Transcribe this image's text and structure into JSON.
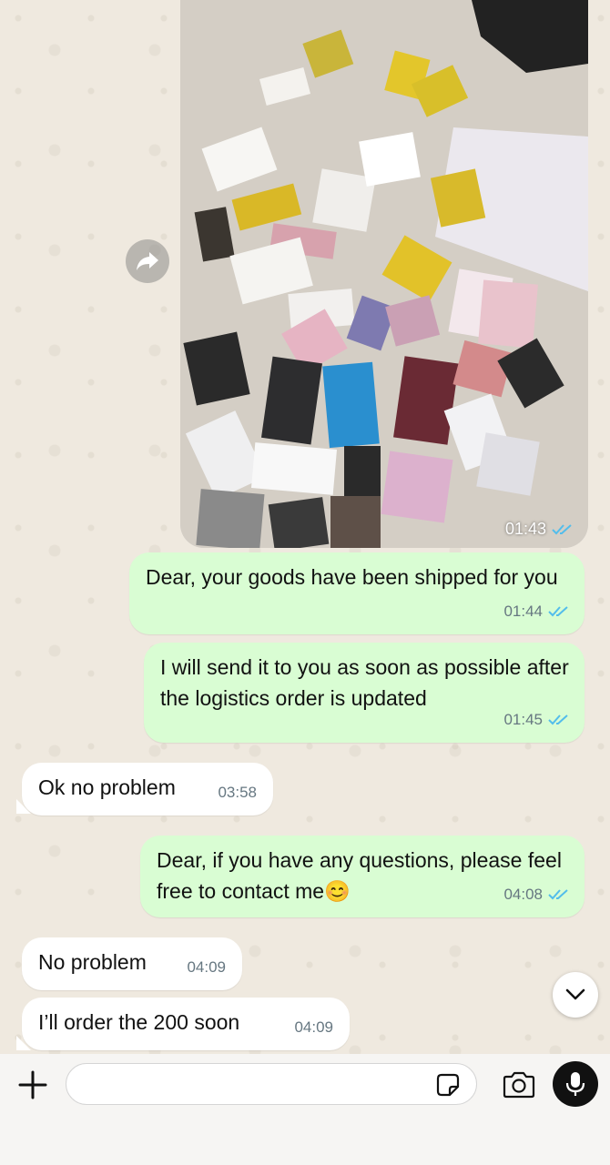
{
  "chat": {
    "image_message": {
      "time": "01:43",
      "status": "read"
    },
    "messages": [
      {
        "direction": "out",
        "text": "Dear, your goods have been shipped for you",
        "time": "01:44",
        "status": "read"
      },
      {
        "direction": "out",
        "text": "I will send it to you as soon as possible after the logistics order is updated",
        "time": "01:45",
        "status": "read"
      },
      {
        "direction": "in",
        "text": "Ok no problem",
        "time": "03:58"
      },
      {
        "direction": "out",
        "text": "Dear, if you have any questions, please feel free to contact me😊",
        "time": "04:08",
        "status": "read"
      },
      {
        "direction": "in",
        "text": "No problem",
        "time": "04:09"
      },
      {
        "direction": "in",
        "text": "I’ll order the 200 soon",
        "time": "04:09"
      }
    ]
  },
  "composer": {
    "placeholder": ""
  },
  "colors": {
    "outgoing_bubble": "#d9fdd3",
    "incoming_bubble": "#ffffff",
    "read_ticks": "#53bdeb",
    "timestamp": "#667781"
  },
  "icons": {
    "forward": "forward-icon",
    "read": "double-check-icon",
    "scroll": "chevron-down-icon",
    "attach": "plus-icon",
    "sticker": "sticker-icon",
    "camera": "camera-icon",
    "mic": "microphone-icon"
  }
}
